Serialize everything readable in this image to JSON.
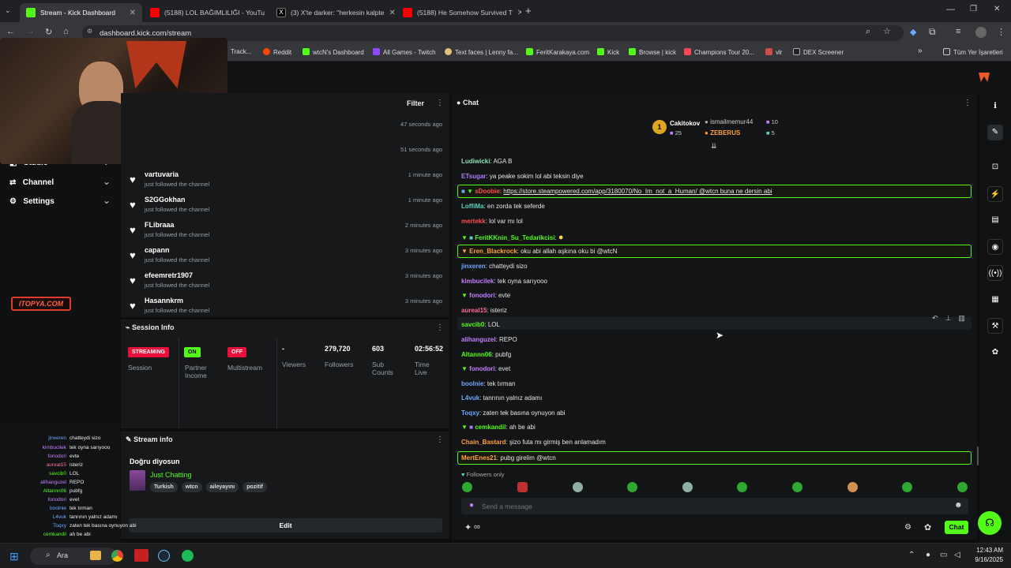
{
  "browser": {
    "tabs": [
      {
        "label": "Stream - Kick Dashboard",
        "color": "#53fc18"
      },
      {
        "label": "(5188) LOL BAĞIMLILIĞI - YouTu",
        "color": "#ff0000"
      },
      {
        "label": "(3) X'te darker: \"herkesin kalpte",
        "color": "#000000"
      },
      {
        "label": "(5188) He Somehow Survived T",
        "color": "#ff0000"
      }
    ],
    "url": "dashboard.kick.com/stream",
    "bookmarks": [
      "Track...",
      "Reddit",
      "wtcN's Dashboard",
      "All Games - Twitch",
      "Text faces | Lenny fa...",
      "FeritKarakaya.com",
      "Kick",
      "Browse | kick",
      "Champions Tour 20...",
      "vlr",
      "DEX Screener"
    ],
    "all_bookmarks": "Tüm Yer İşaretleri"
  },
  "left_nav": [
    {
      "label": "Studio",
      "icon": "studio-icon"
    },
    {
      "label": "Channel",
      "icon": "channel-icon"
    },
    {
      "label": "Settings",
      "icon": "gear-icon"
    }
  ],
  "activity": {
    "filter_label": "Filter",
    "items": [
      {
        "name": "",
        "sub": "",
        "time": "47 seconds ago"
      },
      {
        "name": "",
        "sub": "",
        "time": "51 seconds ago"
      },
      {
        "name": "vartuvaria",
        "sub": "just followed the channel",
        "time": "1 minute ago"
      },
      {
        "name": "S2GGokhan",
        "sub": "just followed the channel",
        "time": "1 minute ago"
      },
      {
        "name": "FLibraaa",
        "sub": "just followed the channel",
        "time": "2 minutes ago"
      },
      {
        "name": "capann",
        "sub": "just followed the channel",
        "time": "3 minutes ago"
      },
      {
        "name": "efeemretr1907",
        "sub": "just followed the channel",
        "time": "3 minutes ago"
      },
      {
        "name": "Hasannkrm",
        "sub": "just followed the channel",
        "time": "3 minutes ago"
      }
    ]
  },
  "session": {
    "title": "Session Info",
    "streaming_badge": "STREAMING",
    "session_label": "Session",
    "partner_badge": "ON",
    "partner_label": "Partner Income",
    "multistream_badge": "OFF",
    "multistream_label": "Multistream",
    "viewers_value": "-",
    "viewers_label": "Viewers",
    "followers_value": "279,720",
    "followers_label": "Followers",
    "subs_value": "603",
    "subs_label": "Sub Counts",
    "time_value": "02:56:52",
    "time_label": "Time Live"
  },
  "stream_info": {
    "title": "Stream info",
    "stream_title": "Doğru diyosun",
    "category": "Just Chatting",
    "tags": [
      "Turkish",
      "wtcn",
      "aileyayını",
      "pozitif"
    ],
    "edit_label": "Edit"
  },
  "chat": {
    "title": "Chat",
    "leaderboard": [
      {
        "name": "Cakitokov",
        "value": "25"
      },
      {
        "name": "ismailmemur44",
        "value": "10"
      },
      {
        "name": "ZEBERUS",
        "value": "5"
      }
    ],
    "rank": "1",
    "messages": [
      {
        "user": "Ludiwicki",
        "color": "#8de0b0",
        "text": "AGA B"
      },
      {
        "user": "ETsugar",
        "color": "#b07cff",
        "text": "ya peake sokim lol abi teksin diye"
      },
      {
        "user": "sDoobie",
        "color": "#ff4d4d",
        "text": "https://store.steampowered.com/app/3180070/No_Im_not_a_Human/ @wtcn buna ne dersin abi",
        "highlight": true
      },
      {
        "user": "LoffiMa",
        "color": "#5fd4c0",
        "text": "en zorda tek seferde"
      },
      {
        "user": "mertekk",
        "color": "#ff5050",
        "text": "lol var mı lol"
      },
      {
        "user": "FeritKKnin_Su_Tedarikcisi",
        "color": "#53fc18",
        "text": ""
      },
      {
        "user": "Eren_Blackrock",
        "color": "#ffa040",
        "text": "oku abi allah aşkına oku bi @wtcN",
        "highlight": true
      },
      {
        "user": "jinxeren",
        "color": "#6fa8ff",
        "text": "chatteydi sizo"
      },
      {
        "user": "kimbucilek",
        "color": "#c77dff",
        "text": "tek oyna sarıyooo"
      },
      {
        "user": "fonodori",
        "color": "#c77dff",
        "text": "evte"
      },
      {
        "user": "aureal15",
        "color": "#ff6b9d",
        "text": "isteriz"
      },
      {
        "user": "savcib0",
        "color": "#53fc18",
        "text": "LOL"
      },
      {
        "user": "alihanguzel",
        "color": "#c77dff",
        "text": "REPO"
      },
      {
        "user": "Altannn06",
        "color": "#53fc18",
        "text": "pubfg"
      },
      {
        "user": "fonodori",
        "color": "#c77dff",
        "text": "evet"
      },
      {
        "user": "boolnie",
        "color": "#6fa8ff",
        "text": "tek tırman"
      },
      {
        "user": "L4vuk",
        "color": "#6fa8ff",
        "text": "tanrının yalnız adamı"
      },
      {
        "user": "Toqxy",
        "color": "#6fa8ff",
        "text": "zaten tek basına oynuyon abi"
      },
      {
        "user": "cemkandil",
        "color": "#53fc18",
        "text": "ah be abi"
      },
      {
        "user": "Chain_Bastard",
        "color": "#ffa040",
        "text": "şizo futa mı girmiş ben anlamadım"
      },
      {
        "user": "MertEnes21",
        "color": "#ffa040",
        "text": "pubg girelim @wtcn",
        "highlight": true
      }
    ],
    "followers_only": "Followers only",
    "placeholder": "Send a message",
    "send_label": "Chat"
  },
  "overlay": {
    "logo_text": "ITOPYA.COM"
  },
  "taskbar": {
    "search": "Ara",
    "time": "12:43 AM",
    "date": "9/16/2025"
  },
  "colors": {
    "accent": "#53fc18",
    "live_red": "#e9113c"
  }
}
